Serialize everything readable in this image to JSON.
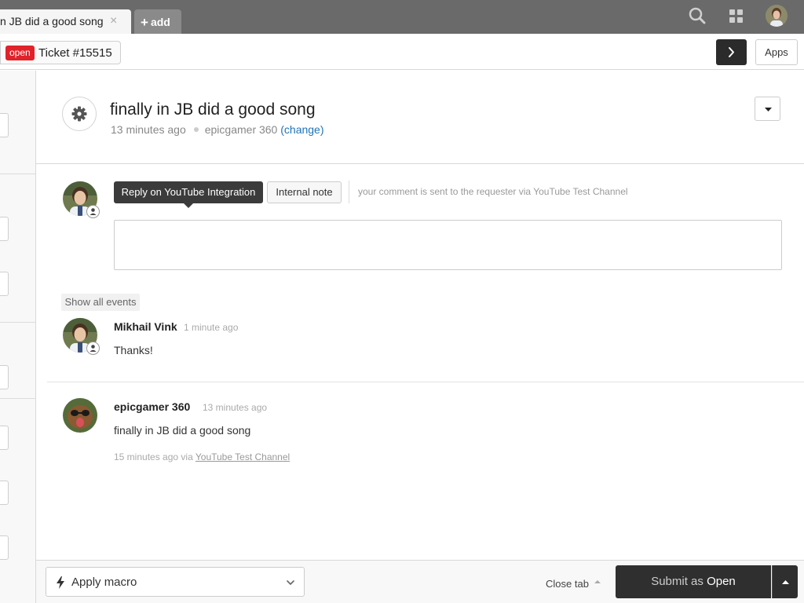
{
  "tabs": {
    "active_title": "n JB did a good song",
    "close_glyph": "×",
    "add_label": "add"
  },
  "ticket": {
    "status_badge": "open",
    "label": "Ticket #15515",
    "apps_label": "Apps"
  },
  "header": {
    "subject": "finally in JB did a good song",
    "time_ago": "13 minutes ago",
    "requester": "epicgamer 360",
    "change_label": "(change)"
  },
  "composer": {
    "reply_tab": "Reply on YouTube Integration",
    "note_tab": "Internal note",
    "hint": "your comment is sent to the requester via YouTube Test Channel",
    "value": ""
  },
  "events": {
    "show_all_label": "Show all events",
    "comments": [
      {
        "author": "Mikhail Vink",
        "time": "1 minute ago",
        "body": "Thanks!"
      },
      {
        "author": "epicgamer 360",
        "time": "13 minutes ago",
        "body": "finally in JB did a good song",
        "meta_time": "15 minutes ago",
        "meta_via": "via",
        "meta_channel": "YouTube Test Channel"
      }
    ]
  },
  "footer": {
    "macro_label": "Apply macro",
    "close_tab_label": "Close tab",
    "submit_prefix": "Submit as",
    "submit_status": "Open"
  },
  "colors": {
    "topbar": "#6a6a6a",
    "open_badge": "#e0222a",
    "link": "#1f73b7",
    "submit_bg": "#2f2f2f"
  }
}
